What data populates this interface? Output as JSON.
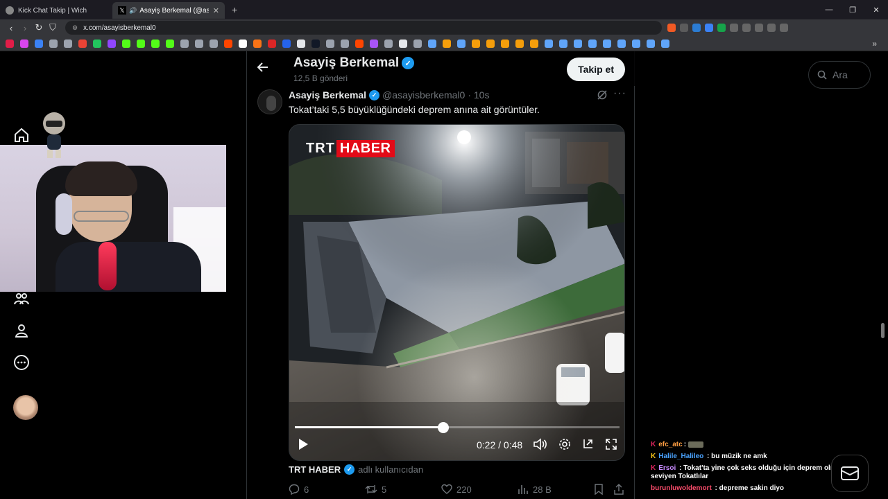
{
  "browser": {
    "tabs": [
      {
        "title": "Kick Chat Takip | Wich",
        "active": false
      },
      {
        "title": "Asayiş Berkemal (@asayisberk",
        "active": true
      }
    ],
    "new_tab": "+",
    "url": "x.com/asayisberkemal0",
    "window_controls": [
      "—",
      "❐",
      "✕"
    ]
  },
  "header": {
    "name": "Asayiş Berkemal",
    "post_count": "12,5 B gönderi",
    "follow_label": "Takip et"
  },
  "search": {
    "placeholder": "Ara"
  },
  "post": {
    "author": "Asayiş Berkemal",
    "handle": "@asayisberkemal0",
    "time": "· 10s",
    "text": "Tokat’taki 5,5 büyüklüğündeki deprem anına ait görüntüler.",
    "video": {
      "brand_a": "TRT",
      "brand_b": "HABER",
      "time": "0:22 / 0:48",
      "progress": 0.4583
    },
    "source": {
      "name": "TRT HABER",
      "suffix": "adlı kullanıcıdan"
    },
    "stats": {
      "replies": "6",
      "reposts": "5",
      "likes": "220",
      "views": "28 B"
    }
  },
  "chat": [
    {
      "badge": "K",
      "badge_color": "#e0245e",
      "user": "efc_atc",
      "user_color": "#ff9f43",
      "message": "",
      "emote": true
    },
    {
      "badge": "K",
      "badge_color": "#f5c518",
      "user": "Halile_Halileo",
      "user_color": "#4aa3ff",
      "message": ": bu müzik ne amk"
    },
    {
      "badge": "K",
      "badge_color": "#e0245e",
      "user": "Ersoi",
      "user_color": "#c98bff",
      "message": ": Tokat'ta yine çok seks olduğu için deprem olmuş, aq seviyen Tokatlılar"
    },
    {
      "badge": "",
      "badge_color": "#e0245e",
      "user": "burunluwoldemort",
      "user_color": "#ff4d6d",
      "message": ": depreme sakin diyo"
    }
  ]
}
